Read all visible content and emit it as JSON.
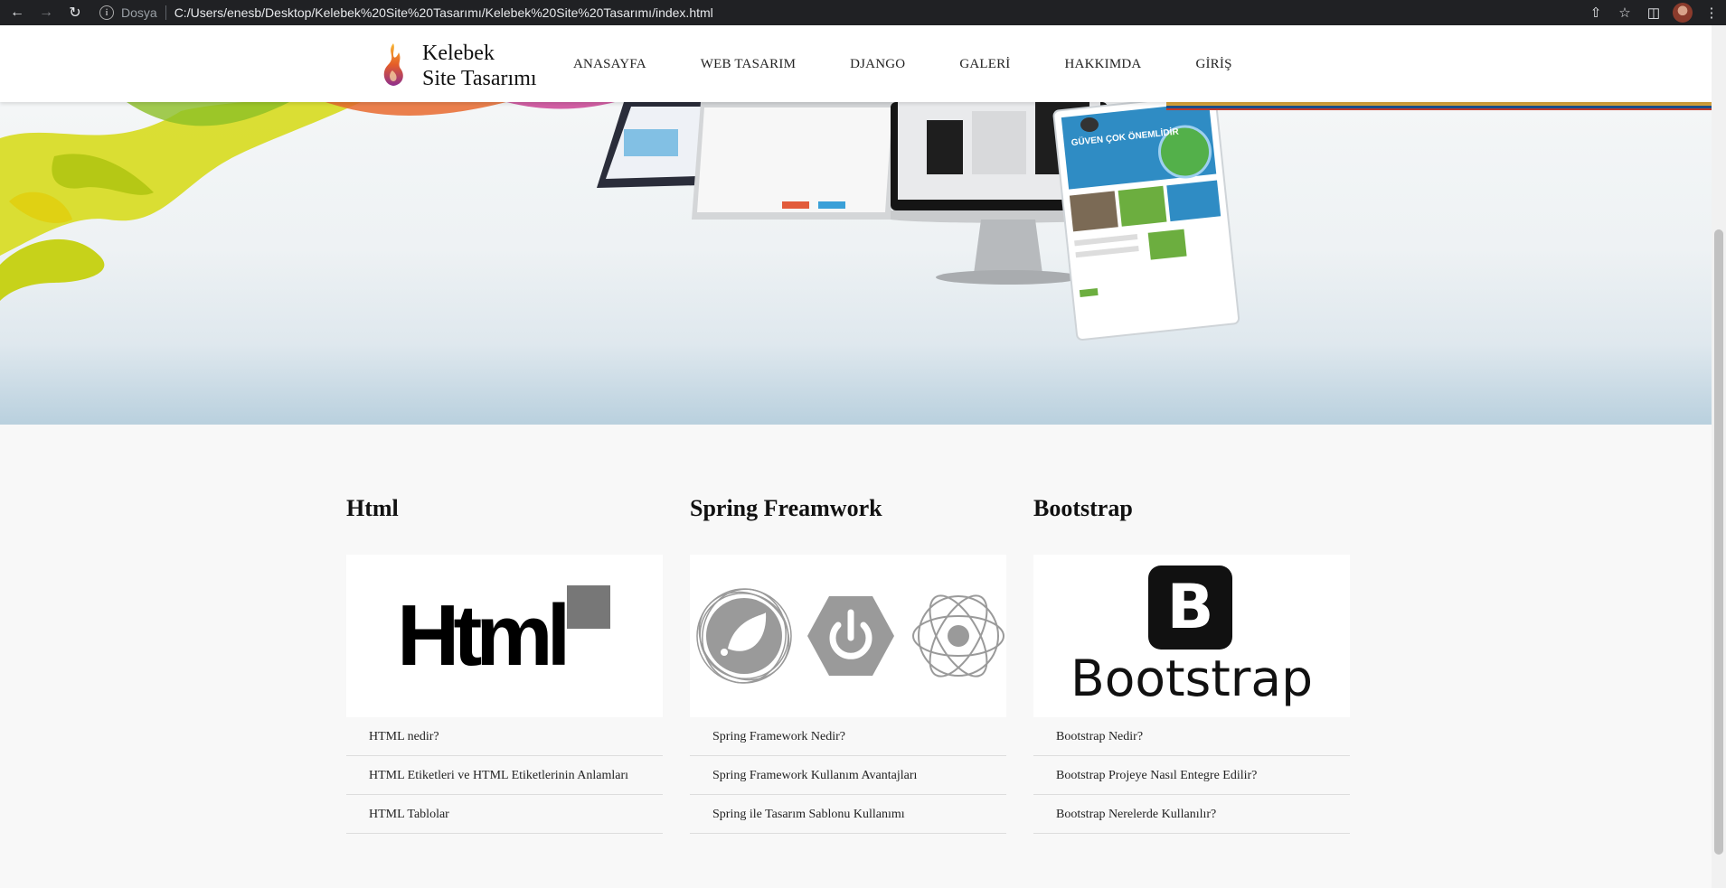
{
  "browser": {
    "scheme_label": "Dosya",
    "url": "C:/Users/enesb/Desktop/Kelebek%20Site%20Tasarımı/Kelebek%20Site%20Tasarımı/index.html"
  },
  "site": {
    "brand_line1": "Kelebek",
    "brand_line2": "Site Tasarımı",
    "menu": [
      "ANASAYFA",
      "WEB TASARIM",
      "DJANGO",
      "GALERİ",
      "HAKKIMDA",
      "GİRİŞ"
    ]
  },
  "sections": [
    {
      "title": "Html",
      "logo_text": "Html",
      "links": [
        "HTML nedir?",
        "HTML Etiketleri ve HTML Etiketlerinin Anlamları",
        "HTML Tablolar"
      ]
    },
    {
      "title": "Spring Freamwork",
      "links": [
        "Spring Framework Nedir?",
        "Spring Framework Kullanım Avantajları",
        "Spring ile Tasarım Sablonu Kullanımı"
      ]
    },
    {
      "title": "Bootstrap",
      "logo_letter": "B",
      "logo_text": "Bootstrap",
      "links": [
        "Bootstrap Nedir?",
        "Bootstrap Projeye Nasıl Entegre Edilir?",
        "Bootstrap Nerelerde Kullanılır?"
      ]
    }
  ],
  "hero": {
    "screen_heading": "GÜVEN ÇOK ÖNEMLİDİR"
  },
  "colors": {
    "chrome_bg": "#202124",
    "flame_orange": "#f39c12",
    "flame_purple": "#8e44ad",
    "ribbon_yellow": "#d7dc1e"
  }
}
